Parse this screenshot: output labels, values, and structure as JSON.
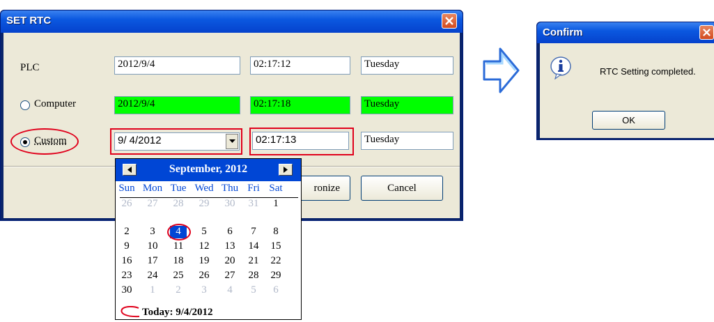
{
  "set_rtc": {
    "title": "SET RTC",
    "rows": {
      "plc": {
        "label": "PLC",
        "date": "2012/9/4",
        "time": "02:17:12",
        "weekday": "Tuesday"
      },
      "computer": {
        "label": "Computer",
        "date": "2012/9/4",
        "time": "02:17:18",
        "weekday": "Tuesday"
      },
      "custom": {
        "label": "Custom",
        "date": "9/ 4/2012",
        "time": "02:17:13",
        "weekday": "Tuesday"
      }
    },
    "buttons": {
      "synchronize": "ronize",
      "cancel": "Cancel"
    }
  },
  "calendar": {
    "month": "September, 2012",
    "weekdays": [
      "Sun",
      "Mon",
      "Tue",
      "Wed",
      "Thu",
      "Fri",
      "Sat"
    ],
    "weeks": [
      [
        "26",
        "27",
        "28",
        "29",
        "30",
        "31",
        "1"
      ],
      [
        "2",
        "3",
        "4",
        "5",
        "6",
        "7",
        "8"
      ],
      [
        "9",
        "10",
        "11",
        "12",
        "13",
        "14",
        "15"
      ],
      [
        "16",
        "17",
        "18",
        "19",
        "20",
        "21",
        "22"
      ],
      [
        "23",
        "24",
        "25",
        "26",
        "27",
        "28",
        "29"
      ],
      [
        "30",
        "1",
        "2",
        "3",
        "4",
        "5",
        "6"
      ]
    ],
    "today": "Today: 9/4/2012"
  },
  "confirm": {
    "title": "Confirm",
    "message": "RTC Setting completed.",
    "ok": "OK"
  },
  "colors": {
    "highlight_green": "#00ff00",
    "annotation_red": "#e0001b",
    "xp_blue": "#0046d5"
  },
  "icons": [
    "close-icon",
    "dropdown-arrow-icon",
    "prev-month-icon",
    "next-month-icon",
    "info-icon",
    "right-arrow-icon"
  ]
}
